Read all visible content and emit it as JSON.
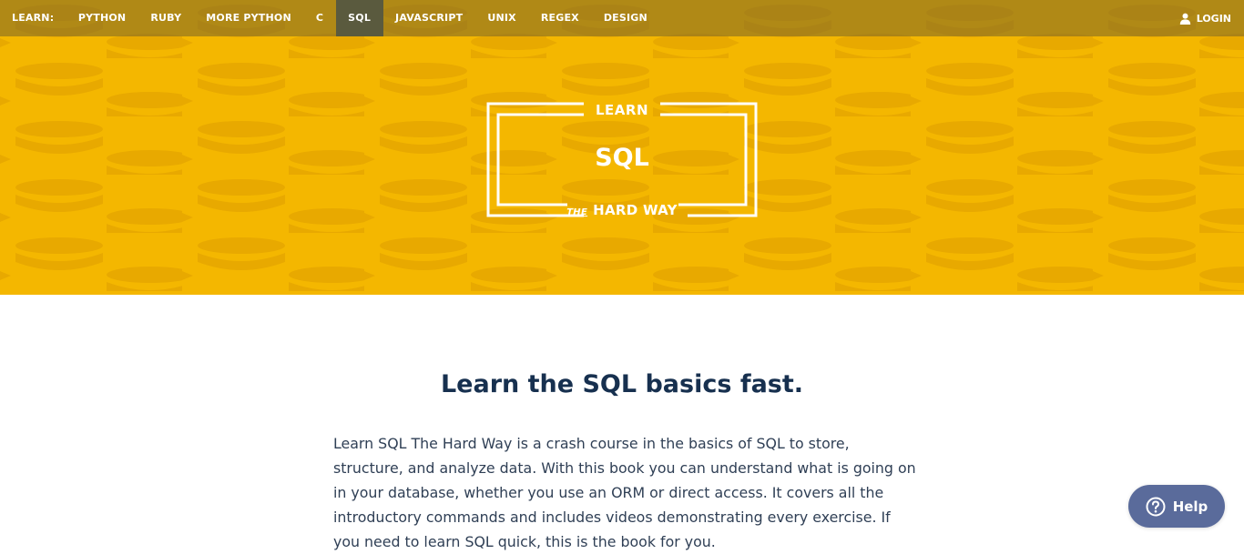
{
  "nav": {
    "label": "LEARN:",
    "items": [
      {
        "label": "PYTHON",
        "active": false
      },
      {
        "label": "RUBY",
        "active": false
      },
      {
        "label": "MORE PYTHON",
        "active": false
      },
      {
        "label": "C",
        "active": false
      },
      {
        "label": "SQL",
        "active": true
      },
      {
        "label": "JAVASCRIPT",
        "active": false
      },
      {
        "label": "UNIX",
        "active": false
      },
      {
        "label": "REGEX",
        "active": false
      },
      {
        "label": "DESIGN",
        "active": false
      }
    ],
    "login_label": "LOGIN",
    "login_icon": "user-icon"
  },
  "logo": {
    "top": "LEARN",
    "middle": "SQL",
    "the": "THE",
    "bottom": "HARD WAY"
  },
  "main": {
    "heading": "Learn the SQL basics fast.",
    "paragraph": "Learn SQL The Hard Way is a crash course in the basics of SQL to store, structure, and analyze data. With this book you can understand what is going on in your database, whether you use an ORM or direct access. It covers all the introductory commands and includes videos demonstrating every exercise. If you need to learn SQL quick, this is the book for you."
  },
  "help": {
    "label": "Help",
    "icon": "question-circle-icon"
  },
  "colors": {
    "hero_bg": "#f4b700",
    "hero_pattern": "#e8a900",
    "heading": "#17304f",
    "help_bg": "#5a6b9b",
    "nav_active": "#5a5a3e"
  }
}
